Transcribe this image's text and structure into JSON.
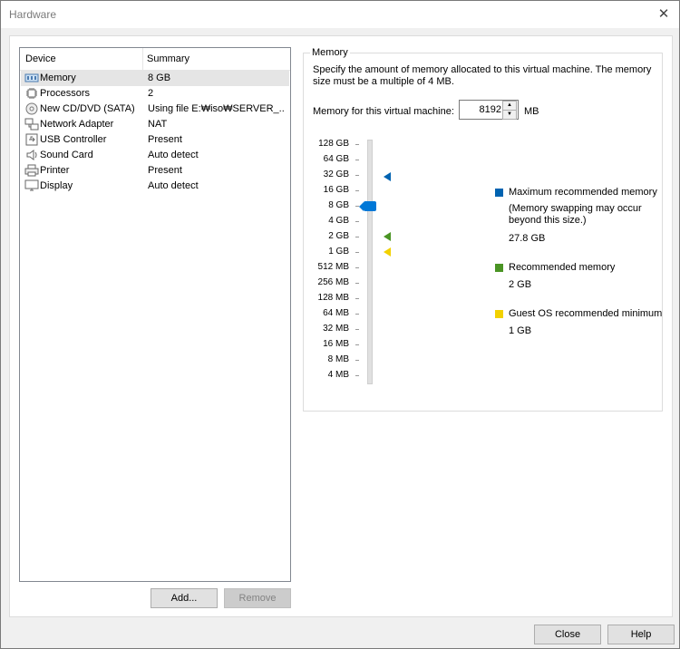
{
  "window": {
    "title": "Hardware"
  },
  "devices": {
    "columns": {
      "device": "Device",
      "summary": "Summary"
    },
    "items": [
      {
        "name": "Memory",
        "summary": "8 GB",
        "icon": "memory-icon"
      },
      {
        "name": "Processors",
        "summary": "2",
        "icon": "processor-icon"
      },
      {
        "name": "New CD/DVD (SATA)",
        "summary": "Using file E:₩iso₩SERVER_...",
        "icon": "cd-dvd-icon"
      },
      {
        "name": "Network Adapter",
        "summary": "NAT",
        "icon": "network-adapter-icon"
      },
      {
        "name": "USB Controller",
        "summary": "Present",
        "icon": "usb-icon"
      },
      {
        "name": "Sound Card",
        "summary": "Auto detect",
        "icon": "speaker-icon"
      },
      {
        "name": "Printer",
        "summary": "Present",
        "icon": "printer-icon"
      },
      {
        "name": "Display",
        "summary": "Auto detect",
        "icon": "display-icon"
      }
    ],
    "selected_index": 0,
    "add_label": "Add...",
    "remove_label": "Remove"
  },
  "memory": {
    "group_label": "Memory",
    "description": "Specify the amount of memory allocated to this virtual machine. The memory size must be a multiple of 4 MB.",
    "field_label": "Memory for this virtual machine:",
    "value": "8192",
    "unit": "MB",
    "scale": [
      "128 GB",
      "64 GB",
      "32 GB",
      "16 GB",
      "8 GB",
      "4 GB",
      "2 GB",
      "1 GB",
      "512 MB",
      "256 MB",
      "128 MB",
      "64 MB",
      "32 MB",
      "16 MB",
      "8 MB",
      "4 MB"
    ],
    "slider_value": "8 GB",
    "legend": {
      "max": {
        "label": "Maximum recommended memory",
        "note": "(Memory swapping may occur beyond this size.)",
        "value": "27.8 GB",
        "color": "#0063b1"
      },
      "recommended": {
        "label": "Recommended memory",
        "value": "2 GB",
        "color": "#4a9424"
      },
      "minimum": {
        "label": "Guest OS recommended minimum",
        "value": "1 GB",
        "color": "#f2d100"
      }
    }
  },
  "footer": {
    "close_label": "Close",
    "help_label": "Help"
  }
}
